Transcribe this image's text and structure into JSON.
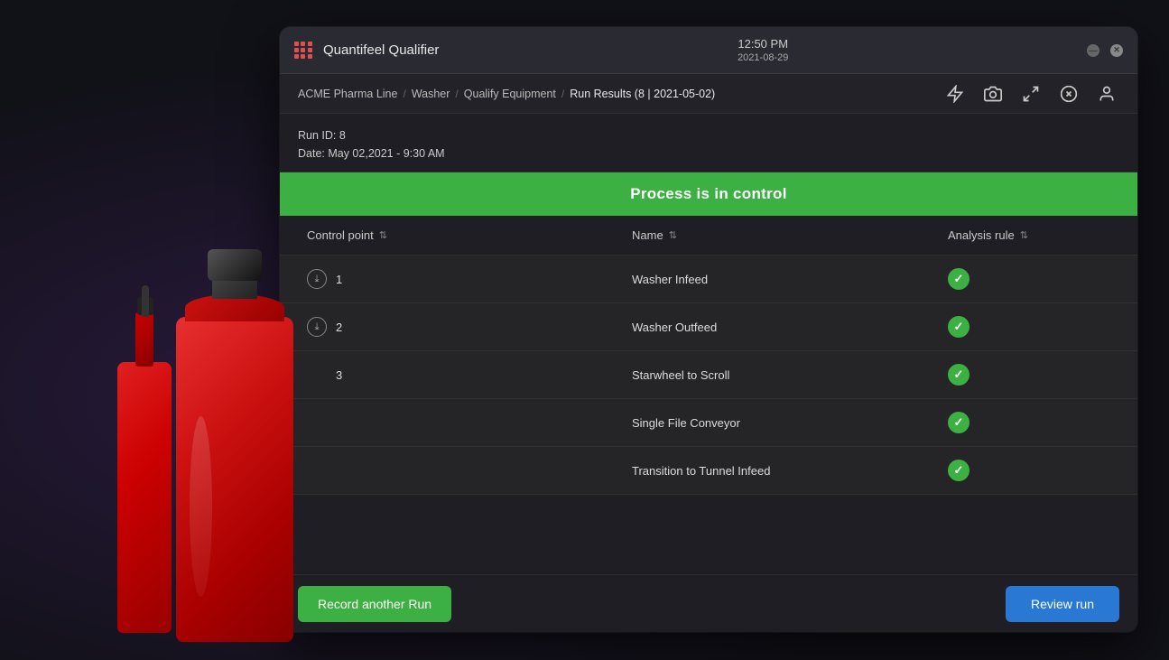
{
  "app": {
    "title": "Quantifeel Qualifier",
    "time": "12:50 PM",
    "date": "2021-08-29"
  },
  "window_controls": {
    "minimize": "—",
    "close": "✕"
  },
  "breadcrumb": {
    "items": [
      {
        "label": "ACME Pharma Line",
        "active": false
      },
      {
        "label": "Washer",
        "active": false
      },
      {
        "label": "Qualify Equipment",
        "active": false
      },
      {
        "label": "Run Results (8 | 2021-05-02)",
        "active": true
      }
    ],
    "separators": [
      "/",
      "/",
      "/"
    ]
  },
  "run_info": {
    "run_id_label": "Run ID: 8",
    "date_label": "Date: May 02,2021 - 9:30 AM"
  },
  "status": {
    "message": "Process is in control",
    "color": "#3db043"
  },
  "table": {
    "columns": [
      {
        "label": "Control point",
        "sortable": true
      },
      {
        "label": "Name",
        "sortable": true
      },
      {
        "label": "Analysis rule",
        "sortable": true
      }
    ],
    "rows": [
      {
        "control_point": "1",
        "name": "Washer Infeed",
        "analysis_rule": "pass",
        "expandable": true
      },
      {
        "control_point": "2",
        "name": "Washer Outfeed",
        "analysis_rule": "pass",
        "expandable": true
      },
      {
        "control_point": "3",
        "name": "Starwheel to Scroll",
        "analysis_rule": "pass",
        "expandable": false
      },
      {
        "control_point": "",
        "name": "Single File Conveyor",
        "analysis_rule": "pass",
        "expandable": false
      },
      {
        "control_point": "",
        "name": "Transition to Tunnel Infeed",
        "analysis_rule": "pass",
        "expandable": false
      }
    ]
  },
  "footer": {
    "record_button": "Record another Run",
    "review_button": "Review run"
  },
  "icons": {
    "bolt": "⚡",
    "camera": "📷",
    "expand": "⤢",
    "close_x": "✕",
    "user": "👤"
  }
}
